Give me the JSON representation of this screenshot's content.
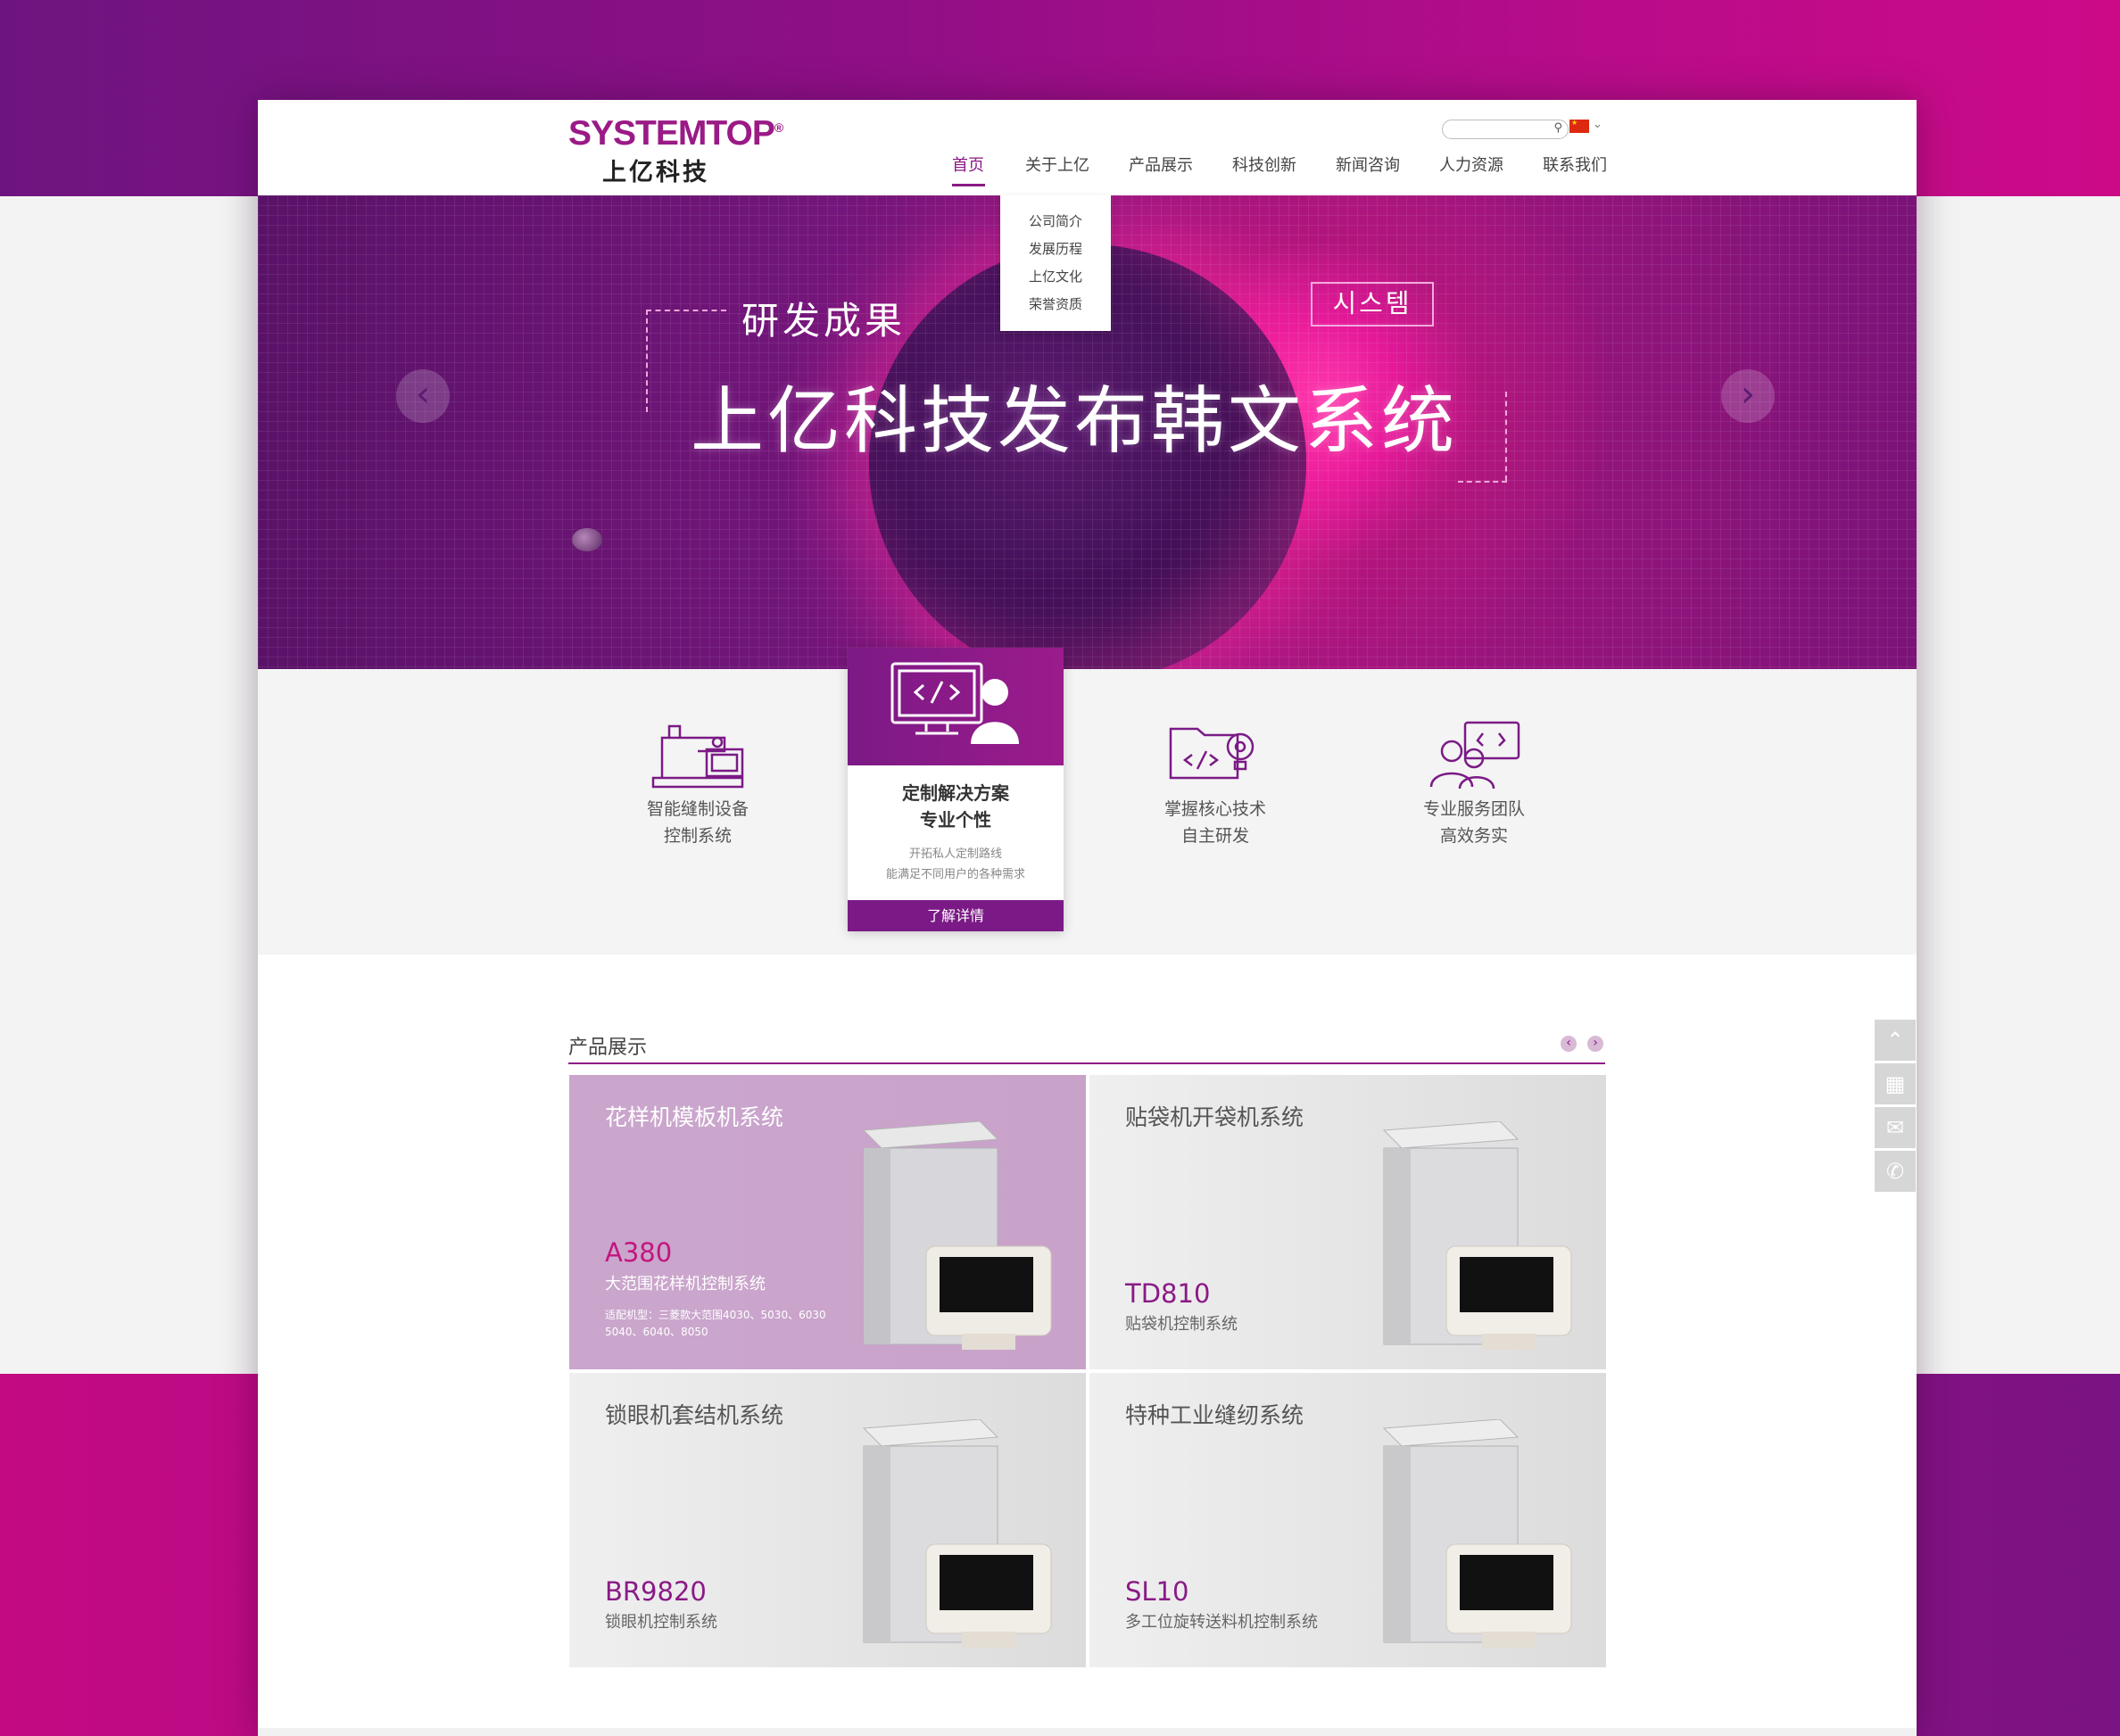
{
  "brand": {
    "name_en": "SYSTEMTOP",
    "reg": "®",
    "name_cn": "上亿科技"
  },
  "header": {
    "search": {
      "placeholder": ""
    },
    "nav": [
      "首页",
      "关于上亿",
      "产品展示",
      "科技创新",
      "新闻咨询",
      "人力资源",
      "联系我们"
    ],
    "active_index": 0,
    "dropdown": [
      "公司简介",
      "发展历程",
      "上亿文化",
      "荣誉资质"
    ]
  },
  "hero": {
    "subtitle": "研发成果",
    "title": "上亿科技发布韩文系统",
    "tag": "시스템",
    "prev": "‹",
    "next": "›"
  },
  "features": [
    {
      "l1": "智能缝制设备",
      "l2": "控制系统",
      "icon": "sewing-machine-icon"
    },
    {
      "l1": "掌握核心技术",
      "l2": "自主研发",
      "icon": "code-folder-gear-icon"
    },
    {
      "l1": "专业服务团队",
      "l2": "高效务实",
      "icon": "team-code-icon"
    }
  ],
  "featured": {
    "t1": "定制解决方案",
    "t2": "专业个性",
    "d1": "开拓私人定制路线",
    "d2": "能满足不同用户的各种需求",
    "button": "了解详情",
    "icon": "monitor-code-user-icon"
  },
  "products": {
    "title": "产品展示",
    "prev": "‹",
    "next": "›",
    "items": [
      {
        "title": "花样机模板机系统",
        "model": "A380",
        "desc": "大范围花样机控制系统",
        "note1": "适配机型：三菱款大范围4030、5030、6030",
        "note2": "5040、6040、8050"
      },
      {
        "title": "贴袋机开袋机系统",
        "model": "TD810",
        "desc": "贴袋机控制系统"
      },
      {
        "title": "锁眼机套结机系统",
        "model": "BR9820",
        "desc": "锁眼机控制系统"
      },
      {
        "title": "特种工业缝纫系统",
        "model": "SL10",
        "desc": "多工位旋转送料机控制系统"
      }
    ]
  },
  "sidetools": [
    "up-arrow-icon",
    "qr-code-icon",
    "mail-icon",
    "phone-icon"
  ],
  "colors": {
    "brand": "#8a1a86",
    "accent": "#e0189a"
  }
}
